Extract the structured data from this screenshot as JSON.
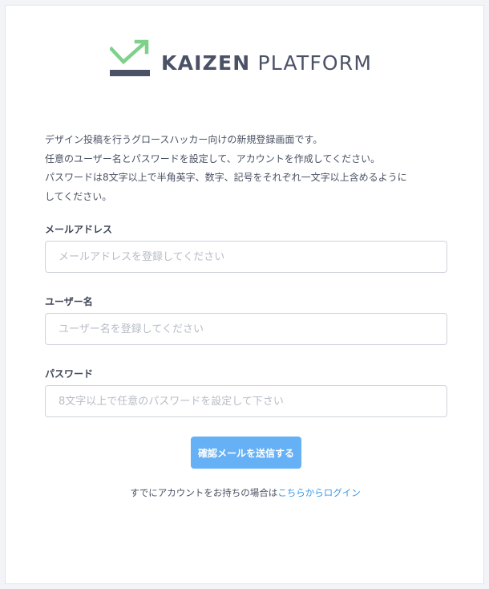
{
  "brand": {
    "name_bold": "KAIZEN",
    "name_regular": "PLATFORM",
    "logo_icon": "check-tray-arrow-icon",
    "colors": {
      "check": "#7ed08a",
      "tray": "#4b5266"
    }
  },
  "intro": {
    "line1": "デザイン投稿を行うグロースハッカー向けの新規登録画面です。",
    "line2": "任意のユーザー名とパスワードを設定して、アカウントを作成してください。",
    "line3": "パスワードは8文字以上で半角英字、数字、記号をそれぞれ一文字以上含めるように",
    "line4": "してください。"
  },
  "form": {
    "email": {
      "label": "メールアドレス",
      "value": "",
      "placeholder": "メールアドレスを登録してください"
    },
    "username": {
      "label": "ユーザー名",
      "value": "",
      "placeholder": "ユーザー名を登録してください"
    },
    "password": {
      "label": "パスワード",
      "value": "",
      "placeholder": "8文字以上で任意のパスワードを設定して下さい"
    },
    "submit_label": "確認メールを送信する"
  },
  "login": {
    "prefix": "すでにアカウントをお持ちの場合は",
    "link_label": "こちらからログイン"
  },
  "colors": {
    "accent_button": "#66b1f6",
    "link": "#3d9ae8",
    "text": "#4a5263",
    "background": "#f3f4f7"
  }
}
